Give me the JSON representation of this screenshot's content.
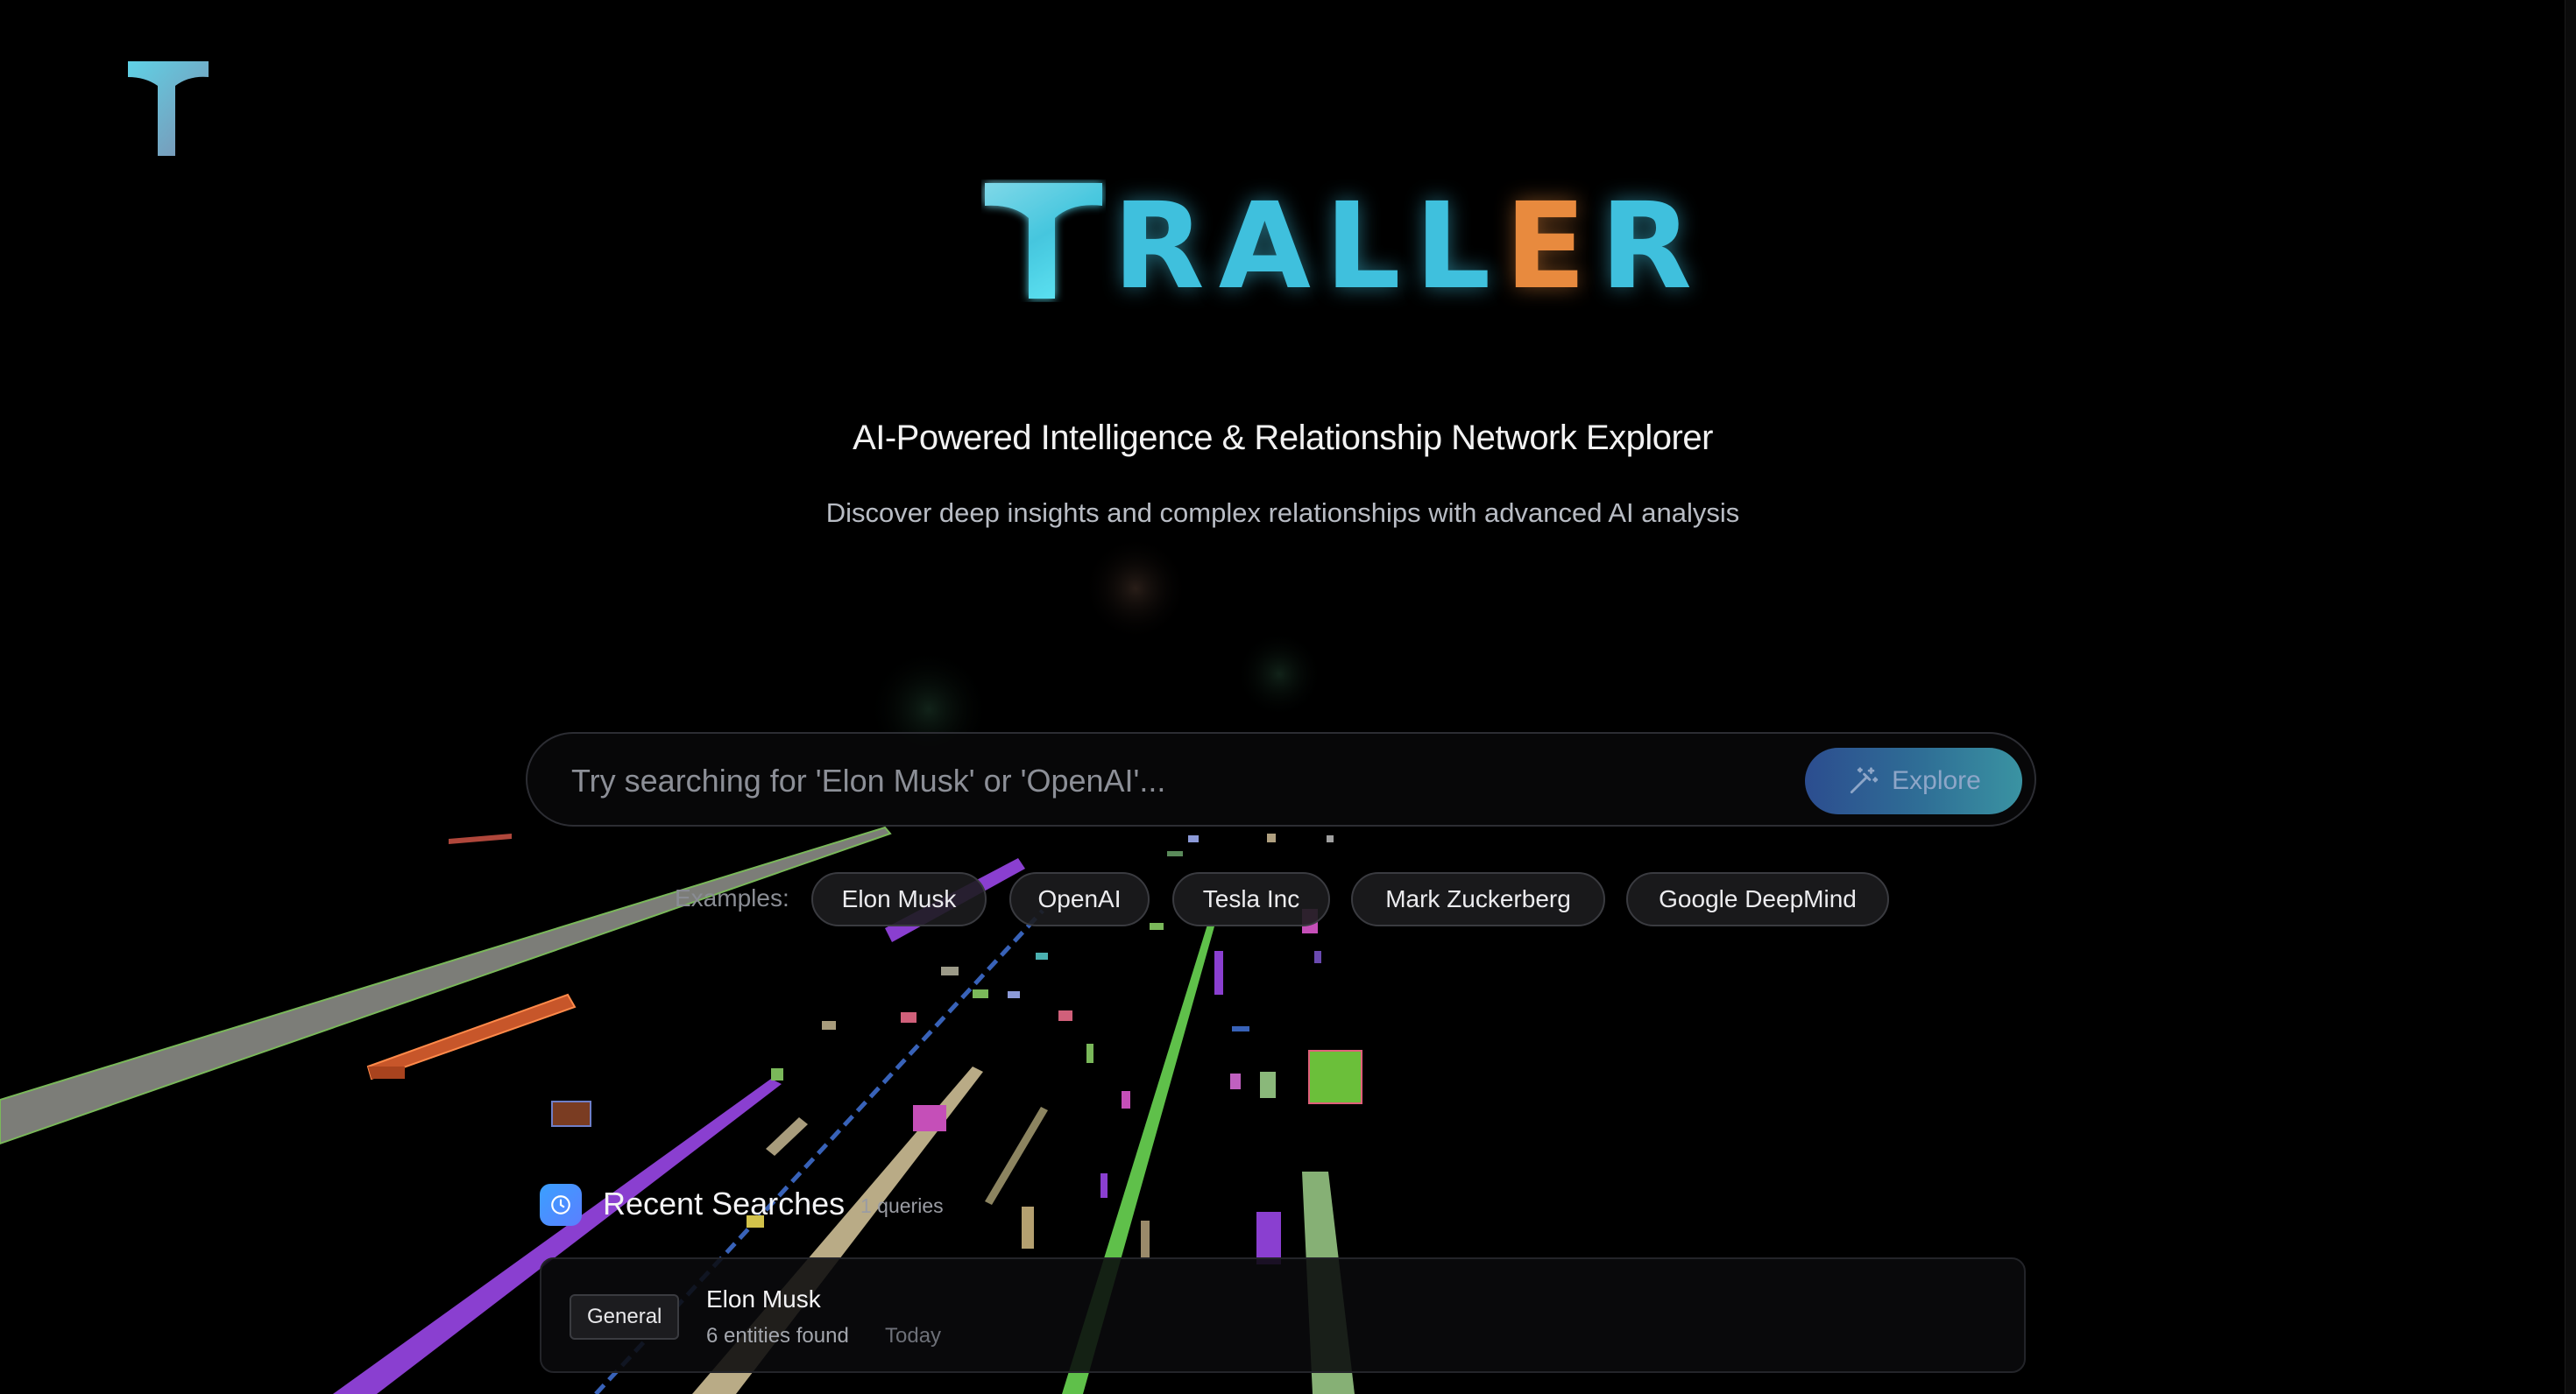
{
  "brand": {
    "name_letters": [
      "R",
      "A",
      "L",
      "L",
      "E",
      "R"
    ],
    "logo_label": "T",
    "colors": {
      "cyan": "#3fc0dd",
      "orange": "#e88a3e"
    }
  },
  "hero": {
    "tagline": "AI-Powered Intelligence & Relationship Network Explorer",
    "subtitle": "Discover deep insights and complex relationships with advanced AI analysis"
  },
  "search": {
    "placeholder": "Try searching for 'Elon Musk' or 'OpenAI'...",
    "value": "",
    "button_label": "Explore",
    "button_icon": "magic-wand-icon"
  },
  "examples": {
    "label": "Examples:",
    "items": [
      "Elon Musk",
      "OpenAI",
      "Tesla Inc",
      "Mark Zuckerberg",
      "Google DeepMind"
    ]
  },
  "recent": {
    "icon": "clock-icon",
    "title": "Recent Searches",
    "count": "1 queries",
    "items": [
      {
        "category": "General",
        "title": "Elon Musk",
        "meta": "6 entities found",
        "date": "Today"
      }
    ]
  }
}
